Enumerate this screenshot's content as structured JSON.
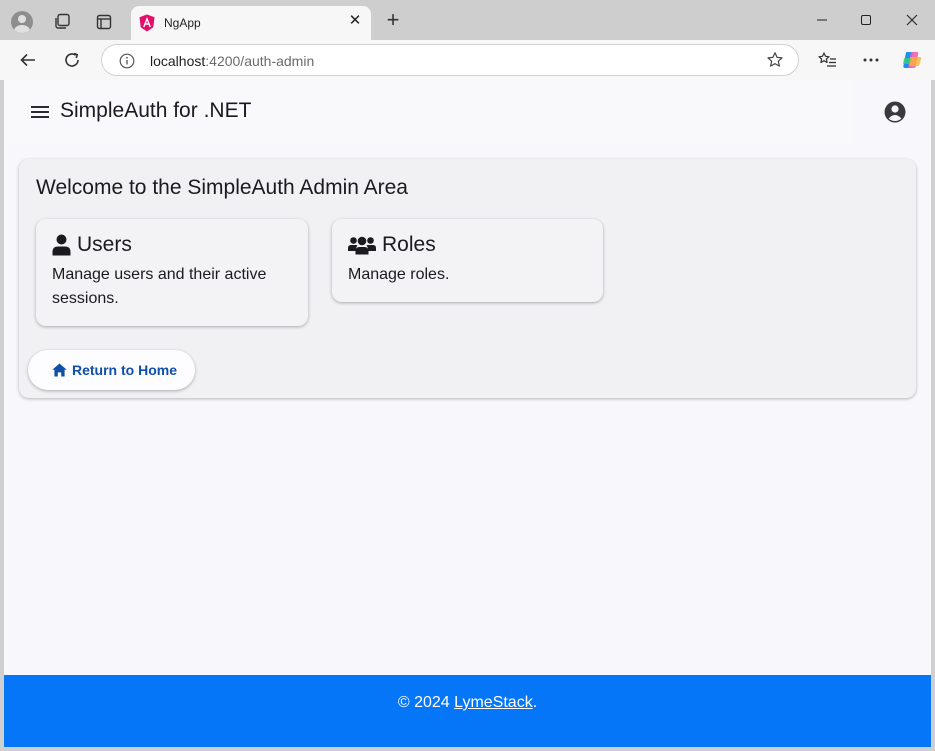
{
  "browser": {
    "tab": {
      "title": "NgApp"
    },
    "address": {
      "host": "localhost",
      "path": ":4200/auth-admin"
    }
  },
  "app": {
    "title": "SimpleAuth for .NET",
    "admin": {
      "title": "Welcome to the SimpleAuth Admin Area",
      "cards": [
        {
          "title": "Users",
          "description": "Manage users and their active sessions.",
          "icon": "user-icon"
        },
        {
          "title": "Roles",
          "description": "Manage roles.",
          "icon": "users-group-icon"
        }
      ],
      "home_button": {
        "label": "Return to Home",
        "icon": "home-icon"
      }
    },
    "footer": {
      "prefix": "© 2024 ",
      "link": "LymeStack",
      "suffix": "."
    }
  },
  "colors": {
    "footer_bg": "#0576f7",
    "button_text": "#0f4fa8",
    "angular_logo": "#e40f6b"
  }
}
